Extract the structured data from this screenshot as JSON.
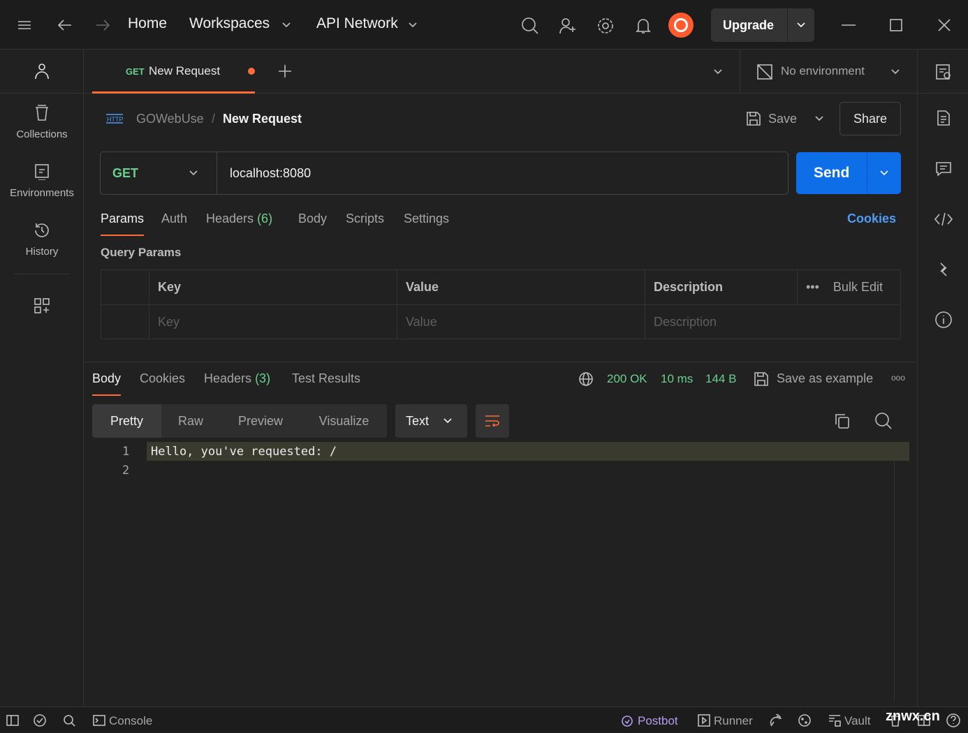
{
  "topbar": {
    "home": "Home",
    "workspaces": "Workspaces",
    "api_network": "API Network",
    "upgrade": "Upgrade"
  },
  "sidebar": {
    "items": [
      {
        "label": "Collections"
      },
      {
        "label": "Environments"
      },
      {
        "label": "History"
      }
    ]
  },
  "tabs": [
    {
      "method": "GET",
      "label": "New Request",
      "unsaved": true
    }
  ],
  "environment": "No environment",
  "breadcrumb": {
    "collection": "GOWebUse",
    "separator": "/",
    "request": "New Request"
  },
  "actions": {
    "save": "Save",
    "share": "Share"
  },
  "request": {
    "method": "GET",
    "url": "localhost:8080",
    "send": "Send"
  },
  "request_tabs": {
    "params": "Params",
    "auth": "Auth",
    "headers": "Headers",
    "headers_count": "(6)",
    "body": "Body",
    "scripts": "Scripts",
    "settings": "Settings",
    "cookies": "Cookies"
  },
  "query_params": {
    "title": "Query Params",
    "columns": [
      "Key",
      "Value",
      "Description"
    ],
    "bulk_edit": "Bulk Edit",
    "placeholders": {
      "key": "Key",
      "value": "Value",
      "description": "Description"
    }
  },
  "response": {
    "tabs": {
      "body": "Body",
      "cookies": "Cookies",
      "headers": "Headers",
      "headers_count": "(3)",
      "tests": "Test Results"
    },
    "status": "200 OK",
    "time": "10 ms",
    "size": "144 B",
    "save_example": "Save as example",
    "views": [
      "Pretty",
      "Raw",
      "Preview",
      "Visualize"
    ],
    "format": "Text",
    "lines": [
      {
        "n": "1",
        "text": "Hello, you've requested: /"
      },
      {
        "n": "2",
        "text": ""
      }
    ]
  },
  "bottom": {
    "console": "Console",
    "postbot": "Postbot",
    "runner": "Runner",
    "vault": "Vault",
    "watermark": "znwx.cn"
  },
  "colors": {
    "accent": "#ff6c37",
    "send": "#0d6ee8",
    "success": "#6bcf8d",
    "link": "#4d9cf5",
    "postbot": "#b79cf2"
  }
}
